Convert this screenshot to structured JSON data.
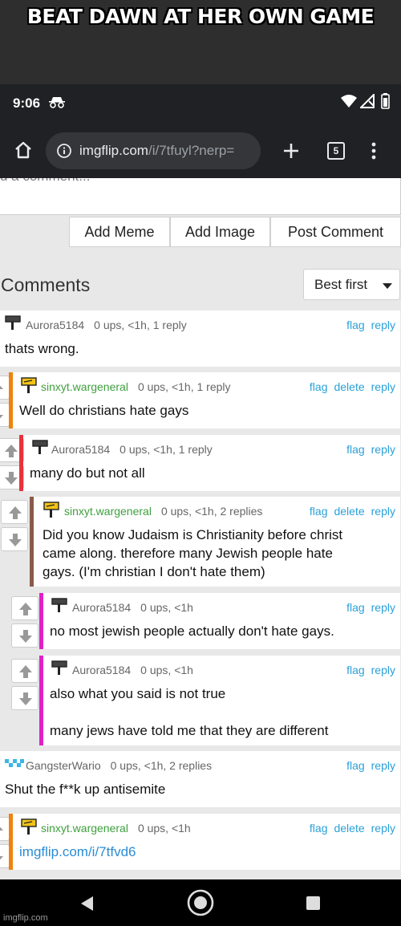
{
  "caption": "BEAT DAWN AT HER OWN GAME",
  "status_bar": {
    "time": "9:06"
  },
  "browser": {
    "url_host": "imgflip.com",
    "url_path": "/i/7tfuyl?nerp=",
    "tab_count": "5"
  },
  "comment_box": {
    "placeholder_fragment": "d a comment..."
  },
  "buttons": {
    "add_meme": "Add Meme",
    "add_image": "Add Image",
    "post_comment": "Post Comment"
  },
  "comments_section": {
    "title": "Comments",
    "sort_label": "Best first"
  },
  "labels": {
    "flag": "flag",
    "delete": "delete",
    "reply": "reply"
  },
  "comments": [
    {
      "user": "Aurora5184",
      "meta": "0 ups, <1h, 1 reply",
      "text": [
        "thats wrong."
      ],
      "depth": 0,
      "bar_color": "",
      "own": false
    },
    {
      "user": "sinxyt.wargeneral",
      "meta": "0 ups, <1h, 1 reply",
      "text": [
        "Well do christians hate gays"
      ],
      "depth": 1,
      "bar_color": "#f0820f",
      "own": true
    },
    {
      "user": "Aurora5184",
      "meta": "0 ups, <1h, 1 reply",
      "text": [
        "many do but not all"
      ],
      "depth": 2,
      "bar_color": "#e8323c",
      "own": false
    },
    {
      "user": "sinxyt.wargeneral",
      "meta": "0 ups, <1h, 2 replies",
      "text": [
        "Did you know Judaism is Christianity before christ",
        "came along. therefore many Jewish people hate",
        "gays. (I'm christian I don't hate them)"
      ],
      "depth": 3,
      "bar_color": "#8b5a4a",
      "own": true
    },
    {
      "user": "Aurora5184",
      "meta": "0 ups, <1h",
      "text": [
        "no most jewish people actually don't hate gays."
      ],
      "depth": 4,
      "bar_color": "#e020c8",
      "own": false
    },
    {
      "user": "Aurora5184",
      "meta": "0 ups, <1h",
      "text": [
        "also what you said is not true",
        "",
        "many jews have told me that they are different"
      ],
      "depth": 4,
      "bar_color": "#e020c8",
      "own": false
    },
    {
      "user": "GangsterWario",
      "meta": "0 ups, <1h, 2 replies",
      "text": [
        "Shut the f**k up antisemite"
      ],
      "depth": 0,
      "bar_color": "",
      "own": false
    },
    {
      "user": "sinxyt.wargeneral",
      "meta": "0 ups, <1h",
      "text": [
        "imgflip.com/i/7tfvd6"
      ],
      "depth": 1,
      "bar_color": "#f0820f",
      "own": true
    }
  ],
  "watermark": "imgflip.com",
  "colors": {
    "link": "#2aa0d8",
    "username_green": "#3fa03f",
    "browser_chrome": "#202124"
  },
  "icons": [
    "incognito-icon",
    "wifi-icon",
    "signal-icon",
    "battery-icon",
    "home-icon",
    "lock-icon",
    "add-tab-icon",
    "tab-switcher-icon",
    "more-icon",
    "upvote-icon",
    "downvote-icon",
    "user-flag-icon",
    "back-icon",
    "home-circle-icon",
    "recents-icon"
  ]
}
